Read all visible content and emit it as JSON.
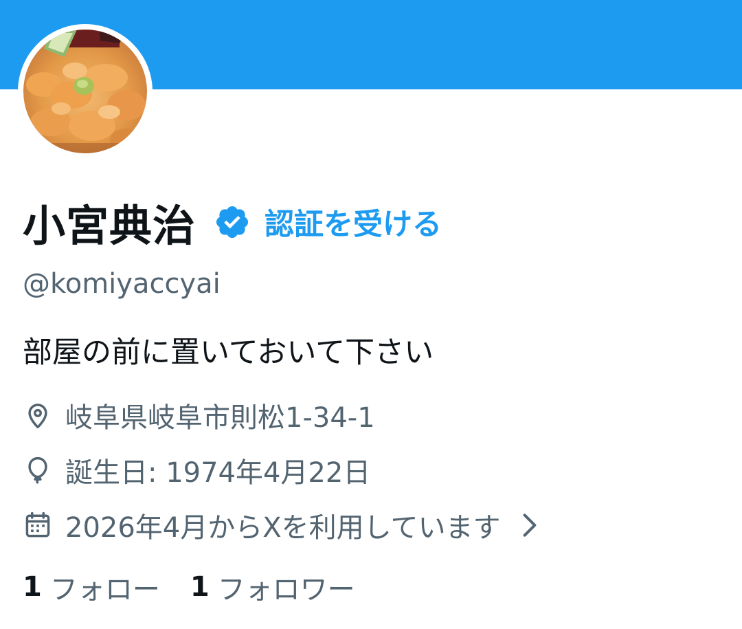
{
  "profile": {
    "display_name": "小宮典治",
    "verify_label": "認証を受ける",
    "handle": "@komiyaccyai",
    "bio": "部屋の前に置いておいて下さい",
    "location": "岐阜県岐阜市則松1-34-1",
    "birthday": "誕生日: 1974年4月22日",
    "joined": "2026年4月からXを利用しています"
  },
  "stats": {
    "following_count": "1",
    "following_label": "フォロー",
    "followers_count": "1",
    "followers_label": "フォロワー"
  },
  "icons": {
    "verified": "verified-badge-icon",
    "location": "location-pin-icon",
    "birthday": "balloon-icon",
    "joined": "calendar-icon",
    "chevron": "chevron-right-icon"
  },
  "colors": {
    "banner": "#1d9bf0",
    "accent": "#1d9bf0",
    "text_primary": "#0f1419",
    "text_secondary": "#536471"
  }
}
